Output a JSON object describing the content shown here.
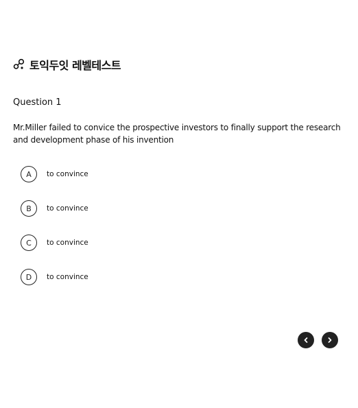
{
  "header": {
    "logo_icon": "connected-dots-icon",
    "title": "토익두잇 레벨테스트"
  },
  "question": {
    "label": "Question 1",
    "text": "Mr.Miller failed to convice the prospective investors to finally support the research and development phase of his invention"
  },
  "options": [
    {
      "letter": "A",
      "text": "to convince"
    },
    {
      "letter": "B",
      "text": "to convince"
    },
    {
      "letter": "C",
      "text": "to convince"
    },
    {
      "letter": "D",
      "text": "to convince"
    }
  ],
  "navigation": {
    "prev_icon": "chevron-left-icon",
    "next_icon": "chevron-right-icon"
  },
  "colors": {
    "text": "#111111",
    "button_bg": "#222222",
    "button_icon": "#ffffff",
    "background": "#ffffff"
  }
}
